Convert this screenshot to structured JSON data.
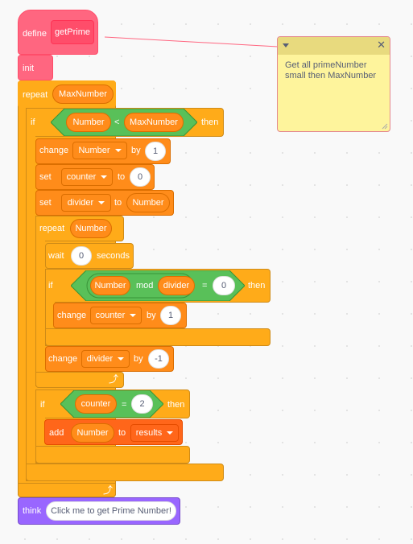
{
  "define_block": {
    "keyword": "define",
    "name": "getPrime"
  },
  "init_block": {
    "label": "init"
  },
  "outer_repeat": {
    "keyword": "repeat",
    "arg": "MaxNumber"
  },
  "if1": {
    "keyword": "if",
    "left": "Number",
    "op": "<",
    "right": "MaxNumber",
    "then": "then"
  },
  "change_number": {
    "keyword": "change",
    "var": "Number",
    "by": "by",
    "value": "1"
  },
  "set_counter": {
    "keyword": "set",
    "var": "counter",
    "to": "to",
    "value": "0"
  },
  "set_divider": {
    "keyword": "set",
    "var": "divider",
    "to": "to",
    "value": "Number"
  },
  "inner_repeat": {
    "keyword": "repeat",
    "arg": "Number"
  },
  "wait_block": {
    "keyword": "wait",
    "value": "0",
    "unit": "seconds"
  },
  "if2": {
    "keyword": "if",
    "left": "Number",
    "mod": "mod",
    "right": "divider",
    "eq": "=",
    "value": "0",
    "then": "then"
  },
  "change_counter": {
    "keyword": "change",
    "var": "counter",
    "by": "by",
    "value": "1"
  },
  "change_divider": {
    "keyword": "change",
    "var": "divider",
    "by": "by",
    "value": "-1"
  },
  "if3": {
    "keyword": "if",
    "left": "counter",
    "eq": "=",
    "value": "2",
    "then": "then"
  },
  "add_block": {
    "keyword": "add",
    "item": "Number",
    "to": "to",
    "list": "results"
  },
  "think_block": {
    "keyword": "think",
    "message": "Click me to get Prime Number!"
  },
  "comment": {
    "text_line1": "Get all primeNumber",
    "text_line2": "small then MaxNumber"
  },
  "colors": {
    "control": "#ffab19",
    "variables": "#ff8c1a",
    "lists": "#ff661a",
    "my_blocks": "#ff6680",
    "operators": "#59c059",
    "looks": "#9966ff",
    "comment": "#fef49c"
  }
}
